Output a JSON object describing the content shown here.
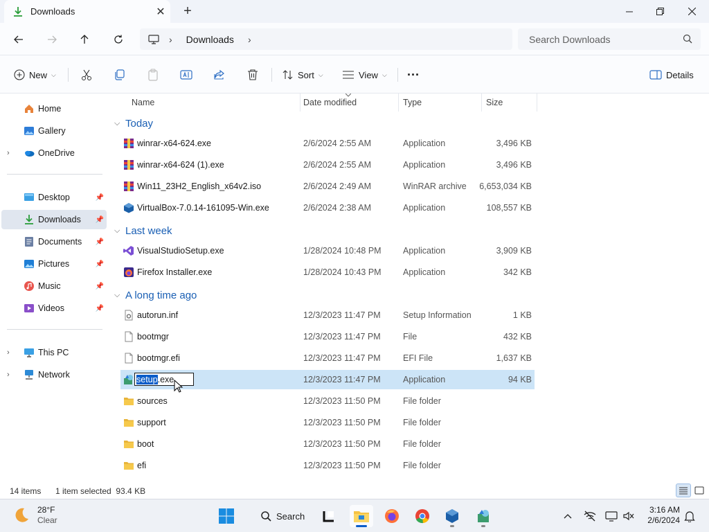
{
  "tab": {
    "title": "Downloads"
  },
  "window": {
    "minimize": "—",
    "maximize": "□",
    "close": "✕"
  },
  "address": {
    "segments": [
      "Downloads"
    ]
  },
  "search": {
    "placeholder": "Search Downloads"
  },
  "toolbar": {
    "new_label": "New",
    "sort_label": "Sort",
    "view_label": "View",
    "more_label": "···",
    "details_label": "Details"
  },
  "sidebar": {
    "items": [
      {
        "label": "Home",
        "icon": "home-icon"
      },
      {
        "label": "Gallery",
        "icon": "gallery-icon"
      },
      {
        "label": "OneDrive",
        "icon": "onedrive-icon"
      },
      {
        "label": "Desktop",
        "icon": "desktop-icon"
      },
      {
        "label": "Downloads",
        "icon": "download-icon"
      },
      {
        "label": "Documents",
        "icon": "documents-icon"
      },
      {
        "label": "Pictures",
        "icon": "pictures-icon"
      },
      {
        "label": "Music",
        "icon": "music-icon"
      },
      {
        "label": "Videos",
        "icon": "videos-icon"
      },
      {
        "label": "This PC",
        "icon": "this-pc-icon"
      },
      {
        "label": "Network",
        "icon": "network-icon"
      }
    ],
    "selected": "Downloads"
  },
  "columns": [
    "Name",
    "Date modified",
    "Type",
    "Size"
  ],
  "groups": [
    {
      "label": "Today",
      "files": [
        {
          "name": "winrar-x64-624.exe",
          "date": "2/6/2024 2:55 AM",
          "type": "Application",
          "size": "3,496 KB",
          "icon": "winrar-icon"
        },
        {
          "name": "winrar-x64-624 (1).exe",
          "date": "2/6/2024 2:55 AM",
          "type": "Application",
          "size": "3,496 KB",
          "icon": "winrar-icon"
        },
        {
          "name": "Win11_23H2_English_x64v2.iso",
          "date": "2/6/2024 2:49 AM",
          "type": "WinRAR archive",
          "size": "6,653,034 KB",
          "icon": "winrar-icon"
        },
        {
          "name": "VirtualBox-7.0.14-161095-Win.exe",
          "date": "2/6/2024 2:38 AM",
          "type": "Application",
          "size": "108,557 KB",
          "icon": "virtualbox-icon"
        }
      ]
    },
    {
      "label": "Last week",
      "files": [
        {
          "name": "VisualStudioSetup.exe",
          "date": "1/28/2024 10:48 PM",
          "type": "Application",
          "size": "3,909 KB",
          "icon": "visual-studio-icon"
        },
        {
          "name": "Firefox Installer.exe",
          "date": "1/28/2024 10:43 PM",
          "type": "Application",
          "size": "342 KB",
          "icon": "firefox-icon"
        }
      ]
    },
    {
      "label": "A long time ago",
      "files": [
        {
          "name": "autorun.inf",
          "date": "12/3/2023 11:47 PM",
          "type": "Setup Information",
          "size": "1 KB",
          "icon": "settings-file-icon"
        },
        {
          "name": "bootmgr",
          "date": "12/3/2023 11:47 PM",
          "type": "File",
          "size": "432 KB",
          "icon": "file-icon"
        },
        {
          "name": "bootmgr.efi",
          "date": "12/3/2023 11:47 PM",
          "type": "EFI File",
          "size": "1,637 KB",
          "icon": "file-icon"
        },
        {
          "name": "setup.exe",
          "date": "12/3/2023 11:47 PM",
          "type": "Application",
          "size": "94 KB",
          "icon": "setup-icon",
          "rename_selected": "setup",
          "rename_rest": ".exe"
        },
        {
          "name": "sources",
          "date": "12/3/2023 11:50 PM",
          "type": "File folder",
          "size": "",
          "icon": "folder-icon"
        },
        {
          "name": "support",
          "date": "12/3/2023 11:50 PM",
          "type": "File folder",
          "size": "",
          "icon": "folder-icon"
        },
        {
          "name": "boot",
          "date": "12/3/2023 11:50 PM",
          "type": "File folder",
          "size": "",
          "icon": "folder-icon"
        },
        {
          "name": "efi",
          "date": "12/3/2023 11:50 PM",
          "type": "File folder",
          "size": "",
          "icon": "folder-icon"
        }
      ]
    }
  ],
  "status": {
    "items": "14 items",
    "selected": "1 item selected  93.4 KB"
  },
  "taskbar": {
    "weather_temp": "28°F",
    "weather_desc": "Clear",
    "search_label": "Search",
    "time": "3:16 AM",
    "date": "2/6/2024"
  },
  "colors": {
    "accent": "#0a5cc9",
    "group_header": "#1a5fb4",
    "selection": "#cce4f7"
  }
}
